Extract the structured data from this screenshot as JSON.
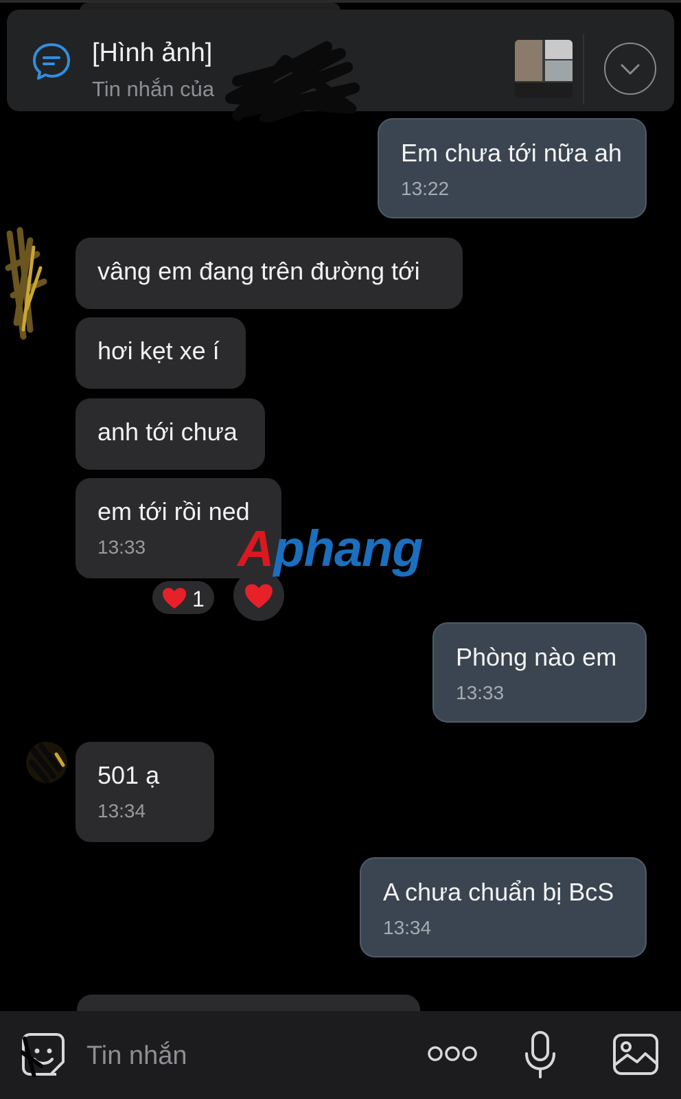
{
  "pinned": {
    "title": "[Hình ảnh]",
    "subtitle": "Tin nhắn của"
  },
  "messages": [
    {
      "direction": "out",
      "text": "Em chưa tới nữa ah",
      "time": "13:22"
    },
    {
      "direction": "in",
      "text": "vâng em đang trên đường tới"
    },
    {
      "direction": "in",
      "text": "hơi kẹt xe í"
    },
    {
      "direction": "in",
      "text": "anh tới chưa"
    },
    {
      "direction": "in",
      "text": "em tới rồi ned",
      "time": "13:33"
    },
    {
      "direction": "out",
      "text": "Phòng nào em",
      "time": "13:33"
    },
    {
      "direction": "in",
      "text": "501 ạ",
      "time": "13:34"
    },
    {
      "direction": "out",
      "text": "A chưa chuẩn bị BcS",
      "time": "13:34"
    }
  ],
  "reaction": {
    "emoji": "heart",
    "count": "1"
  },
  "watermark": {
    "first": "A",
    "rest": "phang"
  },
  "composer": {
    "placeholder": "Tin nhắn"
  },
  "colors": {
    "background": "#000000",
    "incoming_bubble": "#2b2b2d",
    "outgoing_bubble": "#3a4551",
    "accent": "#2f8fe0",
    "heart": "#e8202a"
  }
}
